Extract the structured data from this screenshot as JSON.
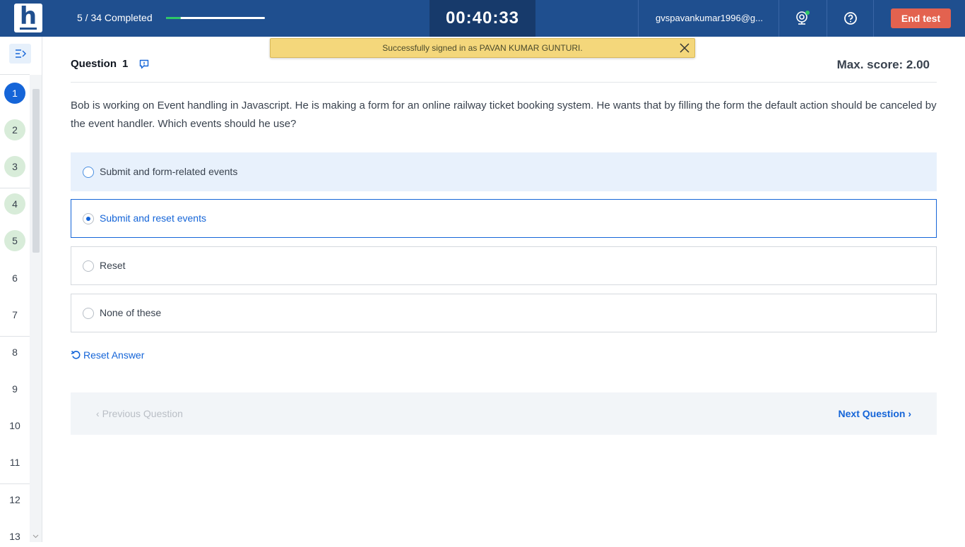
{
  "header": {
    "logo_letter": "h",
    "progress_text": "5 / 34 Completed",
    "progress_fraction": 0.147,
    "timer": "00:40:33",
    "user_email": "gvspavankumar1996@g...",
    "end_test_label": "End test",
    "icons": [
      "webcam-icon",
      "help-icon"
    ]
  },
  "toast": {
    "message": "Successfully signed in as PAVAN KUMAR GUNTURI."
  },
  "sidebar": {
    "questions": [
      {
        "num": "1",
        "state": "current"
      },
      {
        "num": "2",
        "state": "done"
      },
      {
        "num": "3",
        "state": "done"
      },
      {
        "num": "4",
        "state": "done"
      },
      {
        "num": "5",
        "state": "done"
      },
      {
        "num": "6",
        "state": "todo"
      },
      {
        "num": "7",
        "state": "todo"
      },
      {
        "num": "8",
        "state": "todo"
      },
      {
        "num": "9",
        "state": "todo"
      },
      {
        "num": "10",
        "state": "todo"
      },
      {
        "num": "11",
        "state": "todo"
      },
      {
        "num": "12",
        "state": "todo"
      },
      {
        "num": "13",
        "state": "todo"
      }
    ]
  },
  "question": {
    "label": "Question",
    "number": "1",
    "max_score": "Max. score: 2.00",
    "text": "Bob is working on Event handling in Javascript. He is making a form for an online railway ticket booking system. He wants that by filling the form the default action should be canceled by the event handler. Which events should he use?",
    "options": [
      {
        "label": "Submit and form-related events",
        "state": "hover"
      },
      {
        "label": "Submit and reset events",
        "state": "selected"
      },
      {
        "label": "Reset",
        "state": "none"
      },
      {
        "label": "None of these",
        "state": "none"
      }
    ],
    "reset_label": "Reset Answer"
  },
  "nav": {
    "previous_label": "Previous Question",
    "next_label": "Next Question"
  },
  "colors": {
    "header_bg": "#1f4f8f",
    "timer_bg": "#173a6b",
    "accent": "#1565d8",
    "end_button": "#e3624f",
    "progress": "#2ec866",
    "toast": "#f4d77b"
  }
}
